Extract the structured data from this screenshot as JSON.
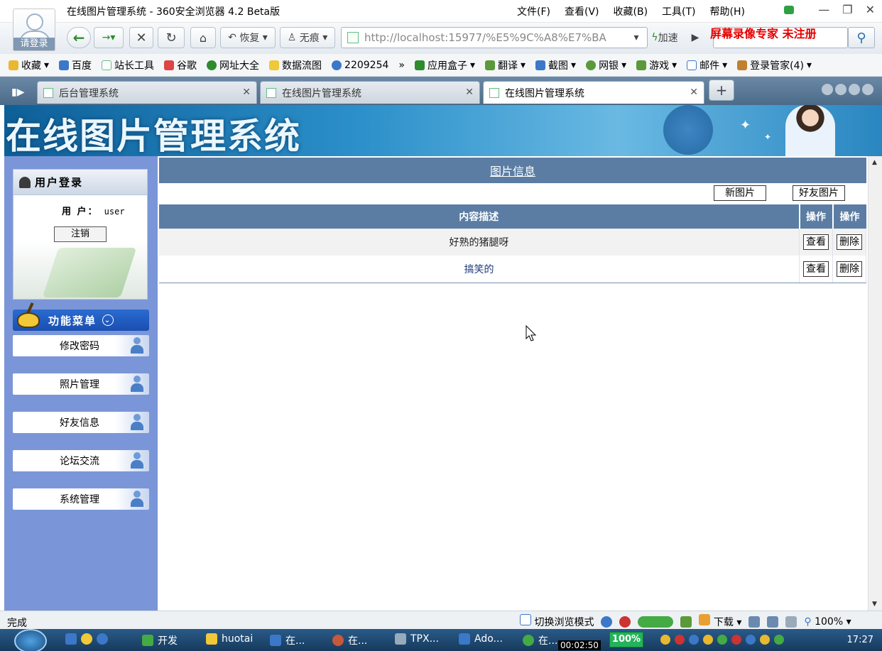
{
  "window": {
    "title": "在线图片管理系统 - 360安全浏览器 4.2 Beta版",
    "avatar_label": "请登录",
    "menus": [
      "文件(F)",
      "查看(V)",
      "收藏(B)",
      "工具(T)",
      "帮助(H)"
    ],
    "controls": [
      "—",
      "❐",
      "✕"
    ]
  },
  "navbar": {
    "restore_label": "恢复",
    "incognito_label": "无痕",
    "address": "http://localhost:15977/%E5%9C%A8%E7%BA",
    "speedup_label": "加速",
    "watermark": "屏幕录像专家  未注册"
  },
  "bookmarks": [
    "收藏",
    "百度",
    "站长工具",
    "谷歌",
    "网址大全",
    "数据流图",
    "2209254",
    "»",
    "应用盒子",
    "翻译",
    "截图",
    "网银",
    "游戏",
    "邮件",
    "登录管家(4)"
  ],
  "tabs": [
    {
      "label": "后台管理系统"
    },
    {
      "label": "在线图片管理系统"
    },
    {
      "label": "在线图片管理系统"
    }
  ],
  "banner": {
    "title": "在线图片管理系统"
  },
  "login": {
    "header": "用户登录",
    "user_label": "用 户：",
    "user_value": "user",
    "logout_label": "注销"
  },
  "menu": {
    "header": "功能菜单",
    "items": [
      "修改密码",
      "照片管理",
      "好友信息",
      "论坛交流",
      "系统管理"
    ]
  },
  "content": {
    "header": "图片信息",
    "new_pic_label": "新图片",
    "friend_pic_label": "好友图片",
    "columns": [
      "内容描述",
      "操作",
      "操作"
    ],
    "rows": [
      {
        "desc": "好熟的猪腿呀",
        "view": "查看",
        "delete": "删除"
      },
      {
        "desc": "搞笑的",
        "view": "查看",
        "delete": "删除"
      }
    ]
  },
  "status": {
    "left": "完成",
    "switch_mode": "切换浏览模式",
    "download": "下载",
    "zoom": "100%"
  },
  "taskbar": {
    "items": [
      "开发",
      "huotai",
      "在...",
      "在...",
      "TPX...",
      "Ado...",
      "在..."
    ],
    "timer": "00:02:50",
    "percent": "100%",
    "clock": "17:27"
  }
}
